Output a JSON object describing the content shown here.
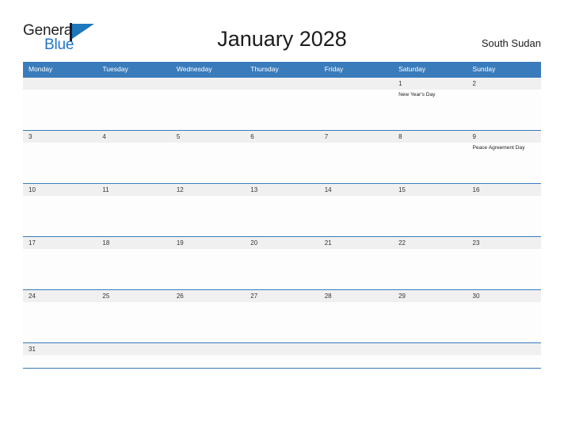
{
  "brand": {
    "word_general": "General",
    "word_blue": "Blue",
    "flag_color": "#1f77bc"
  },
  "header": {
    "title": "January 2028",
    "country": "South Sudan",
    "accent_color": "#3a7cbb"
  },
  "calendar": {
    "month": "January",
    "year": "2028",
    "weekday_headers": [
      "Monday",
      "Tuesday",
      "Wednesday",
      "Thursday",
      "Friday",
      "Saturday",
      "Sunday"
    ],
    "weeks": [
      {
        "days": [
          {
            "num": "",
            "event": ""
          },
          {
            "num": "",
            "event": ""
          },
          {
            "num": "",
            "event": ""
          },
          {
            "num": "",
            "event": ""
          },
          {
            "num": "",
            "event": ""
          },
          {
            "num": "1",
            "event": "New Year's Day"
          },
          {
            "num": "2",
            "event": ""
          }
        ]
      },
      {
        "days": [
          {
            "num": "3",
            "event": ""
          },
          {
            "num": "4",
            "event": ""
          },
          {
            "num": "5",
            "event": ""
          },
          {
            "num": "6",
            "event": ""
          },
          {
            "num": "7",
            "event": ""
          },
          {
            "num": "8",
            "event": ""
          },
          {
            "num": "9",
            "event": "Peace Agreement Day"
          }
        ]
      },
      {
        "days": [
          {
            "num": "10",
            "event": ""
          },
          {
            "num": "11",
            "event": ""
          },
          {
            "num": "12",
            "event": ""
          },
          {
            "num": "13",
            "event": ""
          },
          {
            "num": "14",
            "event": ""
          },
          {
            "num": "15",
            "event": ""
          },
          {
            "num": "16",
            "event": ""
          }
        ]
      },
      {
        "days": [
          {
            "num": "17",
            "event": ""
          },
          {
            "num": "18",
            "event": ""
          },
          {
            "num": "19",
            "event": ""
          },
          {
            "num": "20",
            "event": ""
          },
          {
            "num": "21",
            "event": ""
          },
          {
            "num": "22",
            "event": ""
          },
          {
            "num": "23",
            "event": ""
          }
        ]
      },
      {
        "days": [
          {
            "num": "24",
            "event": ""
          },
          {
            "num": "25",
            "event": ""
          },
          {
            "num": "26",
            "event": ""
          },
          {
            "num": "27",
            "event": ""
          },
          {
            "num": "28",
            "event": ""
          },
          {
            "num": "29",
            "event": ""
          },
          {
            "num": "30",
            "event": ""
          }
        ]
      },
      {
        "days": [
          {
            "num": "31",
            "event": ""
          },
          {
            "num": "",
            "event": ""
          },
          {
            "num": "",
            "event": ""
          },
          {
            "num": "",
            "event": ""
          },
          {
            "num": "",
            "event": ""
          },
          {
            "num": "",
            "event": ""
          },
          {
            "num": "",
            "event": ""
          }
        ]
      }
    ]
  }
}
